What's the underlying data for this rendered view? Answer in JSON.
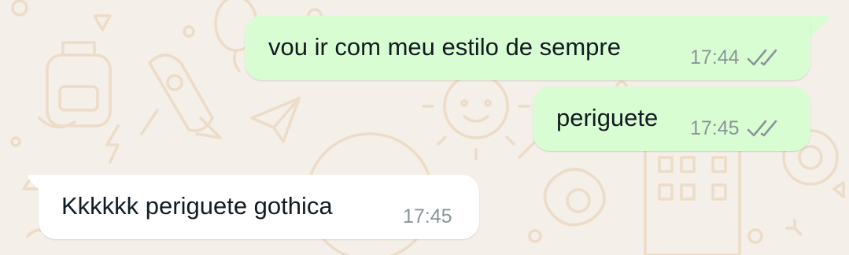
{
  "messages": [
    {
      "direction": "outgoing",
      "text": "vou ir com meu estilo de sempre",
      "time": "17:44",
      "status": "double-check-read-grey"
    },
    {
      "direction": "outgoing",
      "text": "periguete",
      "time": "17:45",
      "status": "double-check-read-grey"
    },
    {
      "direction": "incoming",
      "text": "Kkkkkk periguete gothica",
      "time": "17:45"
    }
  ],
  "colors": {
    "wallpaper": "#f4efe8",
    "wallpaper_doodle": "#ecdcc8",
    "outgoing_bubble": "#d9fdd3",
    "incoming_bubble": "#ffffff",
    "text": "#111b21",
    "meta": "#8a9499"
  }
}
